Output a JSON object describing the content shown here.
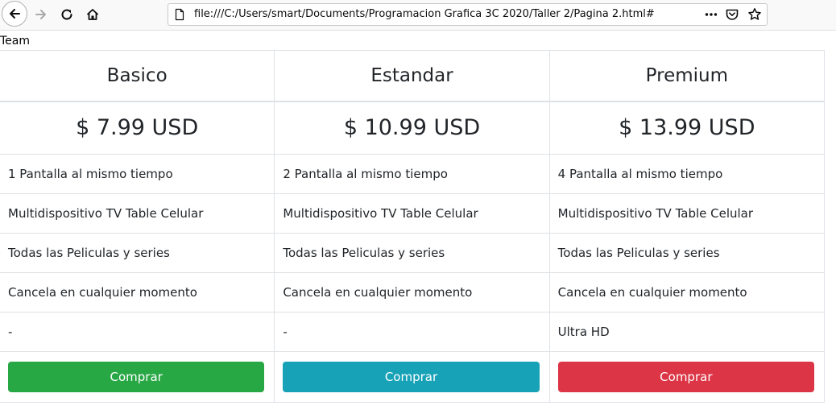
{
  "browser": {
    "url": "file:///C:/Users/smart/Documents/Programacion Grafica 3C 2020/Taller 2/Pagina 2.html#",
    "icons": [
      "back-arrow-icon",
      "forward-arrow-icon",
      "reload-icon",
      "home-icon",
      "page-icon",
      "more-dots-icon",
      "pocket-icon",
      "bookmark-star-icon"
    ]
  },
  "page": {
    "heading": "Team"
  },
  "plans": [
    {
      "name": "Basico",
      "price": "$ 7.99 USD",
      "features": [
        "1 Pantalla al mismo tiempo",
        "Multidispositivo TV Table Celular",
        "Todas las Peliculas y series",
        "Cancela en cualquier momento",
        "-"
      ],
      "button": "Comprar",
      "button_color": "#28a745"
    },
    {
      "name": "Estandar",
      "price": "$ 10.99 USD",
      "features": [
        "2 Pantalla al mismo tiempo",
        "Multidispositivo TV Table Celular",
        "Todas las Peliculas y series",
        "Cancela en cualquier momento",
        "-"
      ],
      "button": "Comprar",
      "button_color": "#17a2b8"
    },
    {
      "name": "Premium",
      "price": "$ 13.99 USD",
      "features": [
        "4 Pantalla al mismo tiempo",
        "Multidispositivo TV Table Celular",
        "Todas las Peliculas y series",
        "Cancela en cualquier momento",
        "Ultra HD"
      ],
      "button": "Comprar",
      "button_color": "#dc3545"
    }
  ]
}
